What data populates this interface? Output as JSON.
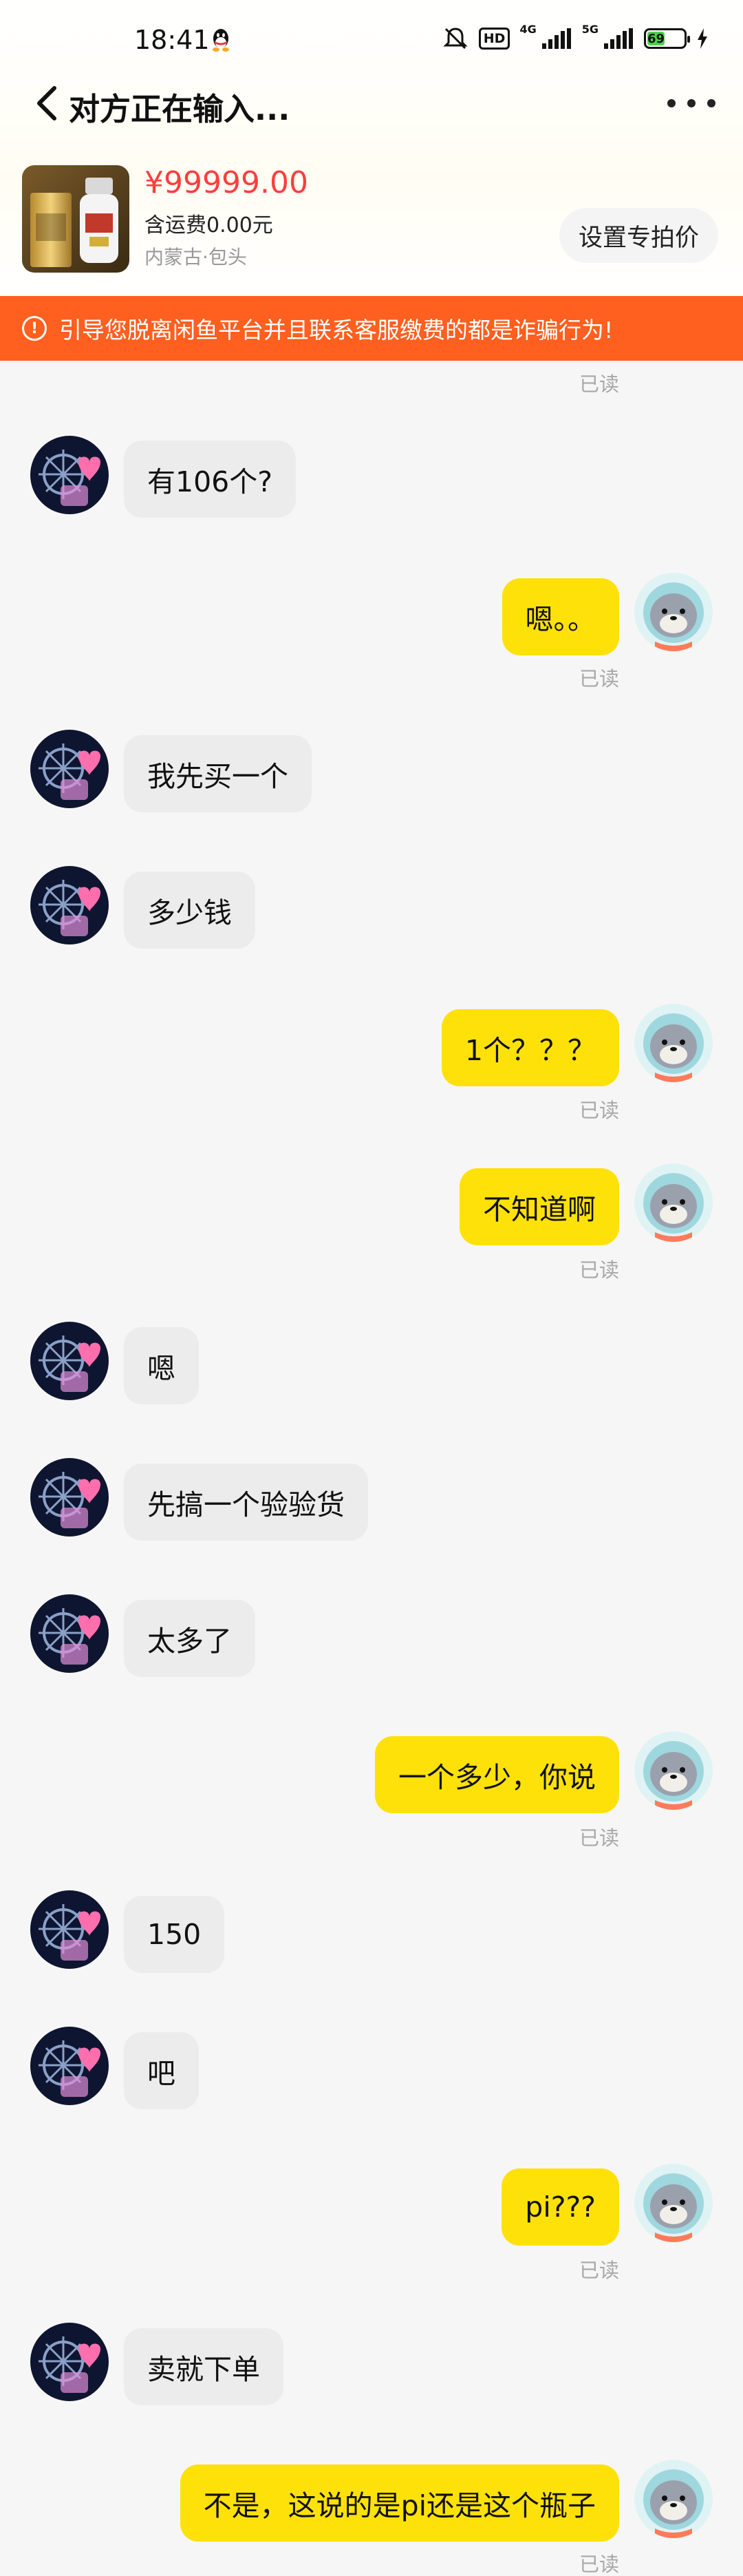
{
  "status_bar": {
    "time": "18:41",
    "hd": "HD",
    "net_4g": "4G",
    "net_5g": "5G",
    "battery": "69"
  },
  "nav": {
    "title": "对方正在输入..."
  },
  "product": {
    "price": "¥99999.00",
    "shipping": "含运费0.00元",
    "location": "内蒙古·包头",
    "special_price_button": "设置专拍价"
  },
  "warning": {
    "text": "引导您脱离闲鱼平台并且联系客服缴费的都是诈骗行为!"
  },
  "chat": {
    "read_label": "已读",
    "messages": [
      {
        "side": "in",
        "text": "有106个?"
      },
      {
        "side": "out",
        "text": "嗯。。"
      },
      {
        "side": "in",
        "text": "我先买一个"
      },
      {
        "side": "in",
        "text": "多少钱"
      },
      {
        "side": "out",
        "text": "1个？？？"
      },
      {
        "side": "out",
        "text": "不知道啊"
      },
      {
        "side": "in",
        "text": "嗯"
      },
      {
        "side": "in",
        "text": "先搞一个验验货"
      },
      {
        "side": "in",
        "text": "太多了"
      },
      {
        "side": "out",
        "text": "一个多少，你说"
      },
      {
        "side": "in",
        "text": "150"
      },
      {
        "side": "in",
        "text": "吧"
      },
      {
        "side": "out",
        "text": "pi???"
      },
      {
        "side": "in",
        "text": "卖就下单"
      },
      {
        "side": "out",
        "text": "不是，这说的是pi还是这个瓶子"
      }
    ]
  },
  "colors": {
    "accent_yellow": "#ffe10a",
    "price_red": "#ff3d3d",
    "warning_orange": "#ff5f1f"
  },
  "icons": [
    "back-arrow-icon",
    "more-dots-icon",
    "warning-circle-icon",
    "mute-icon",
    "signal-icon",
    "battery-icon",
    "qq-icon"
  ]
}
